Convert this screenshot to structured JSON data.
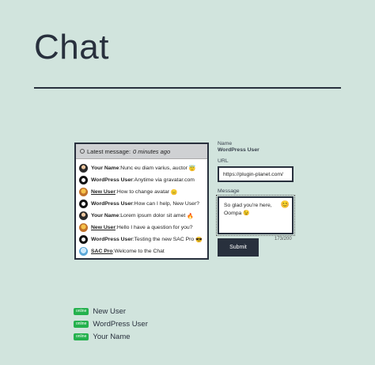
{
  "page": {
    "title": "Chat"
  },
  "chat": {
    "header": {
      "label": "Latest message:",
      "time": "0 minutes ago"
    },
    "messages": [
      {
        "author": "Your Name",
        "linked": false,
        "sep": " : ",
        "text": "Nunc eu diam varius, auctor",
        "emoji": "😇",
        "avatar": "dark-avatar"
      },
      {
        "author": "WordPress User",
        "linked": false,
        "sep": " : ",
        "text": "Anytime via gravatar.com",
        "emoji": "",
        "avatar": "wordpress-avatar"
      },
      {
        "author": "New User",
        "linked": true,
        "sep": " : ",
        "text": "How to change avatar",
        "emoji": "😑",
        "avatar": "warm-avatar"
      },
      {
        "author": "WordPress User",
        "linked": false,
        "sep": " : ",
        "text": "How can I help, New User?",
        "emoji": "",
        "avatar": "wordpress-avatar"
      },
      {
        "author": "Your Name",
        "linked": false,
        "sep": " : ",
        "text": "Lorem ipsum dolor sit amet",
        "emoji": "🔥",
        "avatar": "dark-avatar"
      },
      {
        "author": "New User",
        "linked": true,
        "sep": " : ",
        "text": "Hello I have a question for you?",
        "emoji": "",
        "avatar": "warm-avatar"
      },
      {
        "author": "WordPress User",
        "linked": false,
        "sep": " : ",
        "text": "Testing the new SAC Pro",
        "emoji": "😎",
        "avatar": "wordpress-avatar"
      },
      {
        "author": "SAC Pro",
        "linked": true,
        "sep": " : ",
        "text": "Welcome to the Chat",
        "emoji": "",
        "avatar": "blue-avatar"
      }
    ]
  },
  "form": {
    "name_label": "Name",
    "name_value": "WordPress User",
    "url_label": "URL",
    "url_value": "https://plugin-planet.com/",
    "message_label": "Message",
    "message_value": "So glad you're here, Oompa 😉",
    "emoji_icon": "😊",
    "counter": "173/200",
    "submit_label": "Submit"
  },
  "users_online": [
    {
      "status": "online",
      "name": "New User"
    },
    {
      "status": "online",
      "name": "WordPress User"
    },
    {
      "status": "online",
      "name": "Your Name"
    }
  ],
  "colors": {
    "background": "#d1e4dd",
    "text": "#28303d",
    "badge": "#24b14d"
  }
}
